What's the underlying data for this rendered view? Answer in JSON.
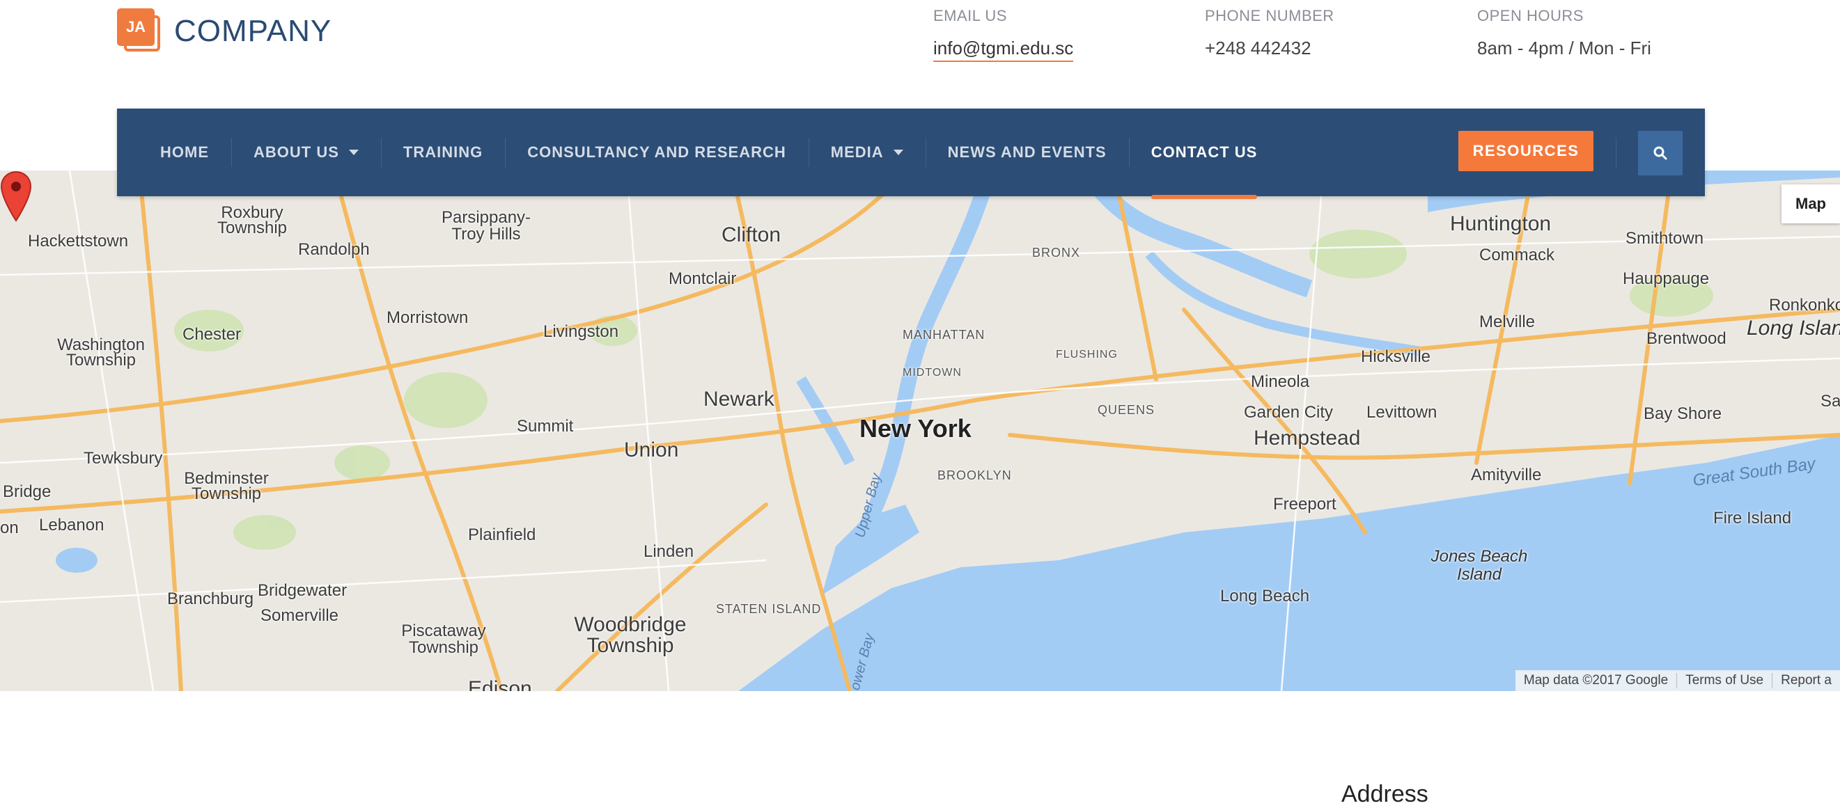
{
  "brand": {
    "logo_letters": "JA",
    "name": "COMPANY"
  },
  "contact": {
    "email_label": "EMAIL US",
    "email_value": "info@tgmi.edu.sc",
    "phone_label": "PHONE NUMBER",
    "phone_value": "+248 442432",
    "hours_label": "OPEN HOURS",
    "hours_value": "8am - 4pm / Mon - Fri"
  },
  "nav": {
    "items": [
      {
        "label": "HOME"
      },
      {
        "label": "ABOUT US"
      },
      {
        "label": "TRAINING"
      },
      {
        "label": "CONSULTANCY AND RESEARCH"
      },
      {
        "label": "MEDIA"
      },
      {
        "label": "NEWS AND EVENTS"
      },
      {
        "label": "CONTACT US"
      }
    ],
    "active": "CONTACT US",
    "resources_label": "RESOURCES",
    "accent_color": "#f07b3f",
    "bar_color": "#2c4d75"
  },
  "map": {
    "type_button": "Map",
    "attribution": [
      "Map data ©2017 Google",
      "Terms of Use",
      "Report a"
    ],
    "places": [
      "New York",
      "Newark",
      "Union",
      "Clifton",
      "Montclair",
      "Livingston",
      "Morristown",
      "Randolph",
      "Hackettstown",
      "Roxbury Township",
      "Parsippany-Troy Hills",
      "Chester",
      "Washington Township",
      "Summit",
      "Tewksbury",
      "Bedminster Township",
      "Bridge",
      "Lebanon",
      "Plainfield",
      "Linden",
      "Bridgewater",
      "Branchburg",
      "Somerville",
      "Piscataway Township",
      "Woodbridge Township",
      "Edison",
      "STATEN ISLAND",
      "BROOKLYN",
      "MANHATTAN",
      "MIDTOWN",
      "BRONX",
      "QUEENS",
      "FLUSHING",
      "Huntington",
      "Commack",
      "Smithtown",
      "Hauppauge",
      "Ronkonkom",
      "Long Island",
      "Melville",
      "Brentwood",
      "Hicksville",
      "Mineola",
      "Garden City",
      "Levittown",
      "Hempstead",
      "Bay Shore",
      "Amityville",
      "Freeport",
      "Long Beach",
      "Jones Beach Island",
      "Fire Island",
      "Great South Bay",
      "Upper Bay",
      "Lower Bay",
      "on",
      "Sa"
    ]
  },
  "section": {
    "address_heading": "Address"
  }
}
